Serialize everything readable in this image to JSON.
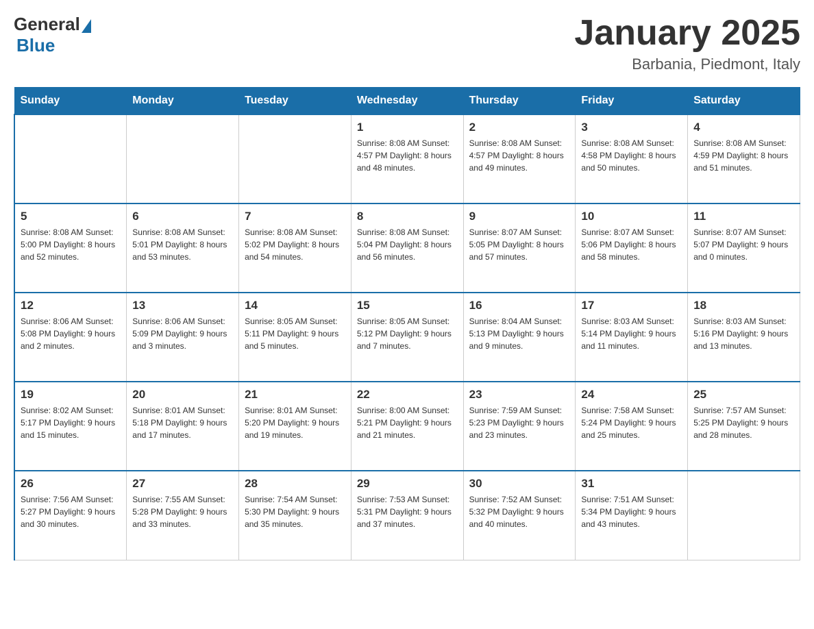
{
  "logo": {
    "general": "General",
    "blue": "Blue"
  },
  "title": "January 2025",
  "location": "Barbania, Piedmont, Italy",
  "days_of_week": [
    "Sunday",
    "Monday",
    "Tuesday",
    "Wednesday",
    "Thursday",
    "Friday",
    "Saturday"
  ],
  "weeks": [
    [
      {
        "num": "",
        "info": ""
      },
      {
        "num": "",
        "info": ""
      },
      {
        "num": "",
        "info": ""
      },
      {
        "num": "1",
        "info": "Sunrise: 8:08 AM\nSunset: 4:57 PM\nDaylight: 8 hours\nand 48 minutes."
      },
      {
        "num": "2",
        "info": "Sunrise: 8:08 AM\nSunset: 4:57 PM\nDaylight: 8 hours\nand 49 minutes."
      },
      {
        "num": "3",
        "info": "Sunrise: 8:08 AM\nSunset: 4:58 PM\nDaylight: 8 hours\nand 50 minutes."
      },
      {
        "num": "4",
        "info": "Sunrise: 8:08 AM\nSunset: 4:59 PM\nDaylight: 8 hours\nand 51 minutes."
      }
    ],
    [
      {
        "num": "5",
        "info": "Sunrise: 8:08 AM\nSunset: 5:00 PM\nDaylight: 8 hours\nand 52 minutes."
      },
      {
        "num": "6",
        "info": "Sunrise: 8:08 AM\nSunset: 5:01 PM\nDaylight: 8 hours\nand 53 minutes."
      },
      {
        "num": "7",
        "info": "Sunrise: 8:08 AM\nSunset: 5:02 PM\nDaylight: 8 hours\nand 54 minutes."
      },
      {
        "num": "8",
        "info": "Sunrise: 8:08 AM\nSunset: 5:04 PM\nDaylight: 8 hours\nand 56 minutes."
      },
      {
        "num": "9",
        "info": "Sunrise: 8:07 AM\nSunset: 5:05 PM\nDaylight: 8 hours\nand 57 minutes."
      },
      {
        "num": "10",
        "info": "Sunrise: 8:07 AM\nSunset: 5:06 PM\nDaylight: 8 hours\nand 58 minutes."
      },
      {
        "num": "11",
        "info": "Sunrise: 8:07 AM\nSunset: 5:07 PM\nDaylight: 9 hours\nand 0 minutes."
      }
    ],
    [
      {
        "num": "12",
        "info": "Sunrise: 8:06 AM\nSunset: 5:08 PM\nDaylight: 9 hours\nand 2 minutes."
      },
      {
        "num": "13",
        "info": "Sunrise: 8:06 AM\nSunset: 5:09 PM\nDaylight: 9 hours\nand 3 minutes."
      },
      {
        "num": "14",
        "info": "Sunrise: 8:05 AM\nSunset: 5:11 PM\nDaylight: 9 hours\nand 5 minutes."
      },
      {
        "num": "15",
        "info": "Sunrise: 8:05 AM\nSunset: 5:12 PM\nDaylight: 9 hours\nand 7 minutes."
      },
      {
        "num": "16",
        "info": "Sunrise: 8:04 AM\nSunset: 5:13 PM\nDaylight: 9 hours\nand 9 minutes."
      },
      {
        "num": "17",
        "info": "Sunrise: 8:03 AM\nSunset: 5:14 PM\nDaylight: 9 hours\nand 11 minutes."
      },
      {
        "num": "18",
        "info": "Sunrise: 8:03 AM\nSunset: 5:16 PM\nDaylight: 9 hours\nand 13 minutes."
      }
    ],
    [
      {
        "num": "19",
        "info": "Sunrise: 8:02 AM\nSunset: 5:17 PM\nDaylight: 9 hours\nand 15 minutes."
      },
      {
        "num": "20",
        "info": "Sunrise: 8:01 AM\nSunset: 5:18 PM\nDaylight: 9 hours\nand 17 minutes."
      },
      {
        "num": "21",
        "info": "Sunrise: 8:01 AM\nSunset: 5:20 PM\nDaylight: 9 hours\nand 19 minutes."
      },
      {
        "num": "22",
        "info": "Sunrise: 8:00 AM\nSunset: 5:21 PM\nDaylight: 9 hours\nand 21 minutes."
      },
      {
        "num": "23",
        "info": "Sunrise: 7:59 AM\nSunset: 5:23 PM\nDaylight: 9 hours\nand 23 minutes."
      },
      {
        "num": "24",
        "info": "Sunrise: 7:58 AM\nSunset: 5:24 PM\nDaylight: 9 hours\nand 25 minutes."
      },
      {
        "num": "25",
        "info": "Sunrise: 7:57 AM\nSunset: 5:25 PM\nDaylight: 9 hours\nand 28 minutes."
      }
    ],
    [
      {
        "num": "26",
        "info": "Sunrise: 7:56 AM\nSunset: 5:27 PM\nDaylight: 9 hours\nand 30 minutes."
      },
      {
        "num": "27",
        "info": "Sunrise: 7:55 AM\nSunset: 5:28 PM\nDaylight: 9 hours\nand 33 minutes."
      },
      {
        "num": "28",
        "info": "Sunrise: 7:54 AM\nSunset: 5:30 PM\nDaylight: 9 hours\nand 35 minutes."
      },
      {
        "num": "29",
        "info": "Sunrise: 7:53 AM\nSunset: 5:31 PM\nDaylight: 9 hours\nand 37 minutes."
      },
      {
        "num": "30",
        "info": "Sunrise: 7:52 AM\nSunset: 5:32 PM\nDaylight: 9 hours\nand 40 minutes."
      },
      {
        "num": "31",
        "info": "Sunrise: 7:51 AM\nSunset: 5:34 PM\nDaylight: 9 hours\nand 43 minutes."
      },
      {
        "num": "",
        "info": ""
      }
    ]
  ]
}
